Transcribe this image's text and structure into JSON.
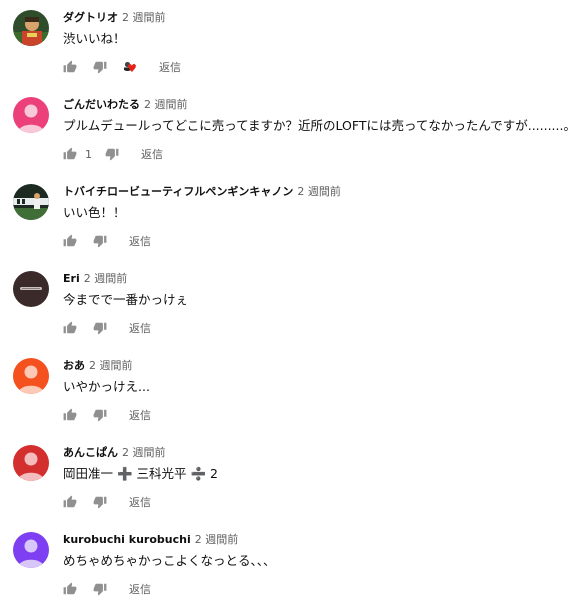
{
  "comments": [
    {
      "author": "ダグトリオ",
      "time": "2 週間前",
      "text": "渋いいね！",
      "like_count": "",
      "reply_label": "返信",
      "creator_heart": true,
      "avatar_icon": "photo-avatar-icon"
    },
    {
      "author": "ごんだいわたる",
      "time": "2 週間前",
      "text": "プルムデュールってどこに売ってますか？近所のLOFTには売ってなかったんですが.........。",
      "like_count": "1",
      "reply_label": "返信",
      "creator_heart": false,
      "avatar_icon": "default-avatar-icon",
      "avatar_color": "#ec407a"
    },
    {
      "author": "トバイチロービューティフルペンギンキャノン",
      "time": "2 週間前",
      "text": "いい色！！",
      "like_count": "",
      "reply_label": "返信",
      "creator_heart": false,
      "avatar_icon": "photo-avatar-icon"
    },
    {
      "author": "Eri",
      "time": "2 週間前",
      "text": "今までで一番かっけぇ",
      "like_count": "",
      "reply_label": "返信",
      "creator_heart": false,
      "avatar_icon": "photo-avatar-icon"
    },
    {
      "author": "おあ",
      "time": "2 週間前",
      "text": "いやかっけえ...",
      "like_count": "",
      "reply_label": "返信",
      "creator_heart": false,
      "avatar_icon": "default-avatar-icon",
      "avatar_color": "#f4511e"
    },
    {
      "author": "あんこぱん",
      "time": "2 週間前",
      "text": "岡田准一 ➕ 三科光平 ➗ 2",
      "like_count": "",
      "reply_label": "返信",
      "creator_heart": false,
      "avatar_icon": "default-avatar-icon",
      "avatar_color": "#d32f2f"
    },
    {
      "author": "kurobuchi kurobuchi",
      "time": "2 週間前",
      "text": "めちゃめちゃかっこよくなっとる、、、",
      "like_count": "",
      "reply_label": "返信",
      "creator_heart": false,
      "avatar_icon": "default-avatar-icon",
      "avatar_color": "#7e3ff2"
    }
  ],
  "icons": {
    "like": "thumb-up-icon",
    "dislike": "thumb-down-icon",
    "heart": "creator-heart-icon"
  },
  "colors": {
    "text_primary": "#0f0f0f",
    "text_secondary": "#606060",
    "icon_gray": "#909090",
    "heart_red": "#e62117"
  }
}
